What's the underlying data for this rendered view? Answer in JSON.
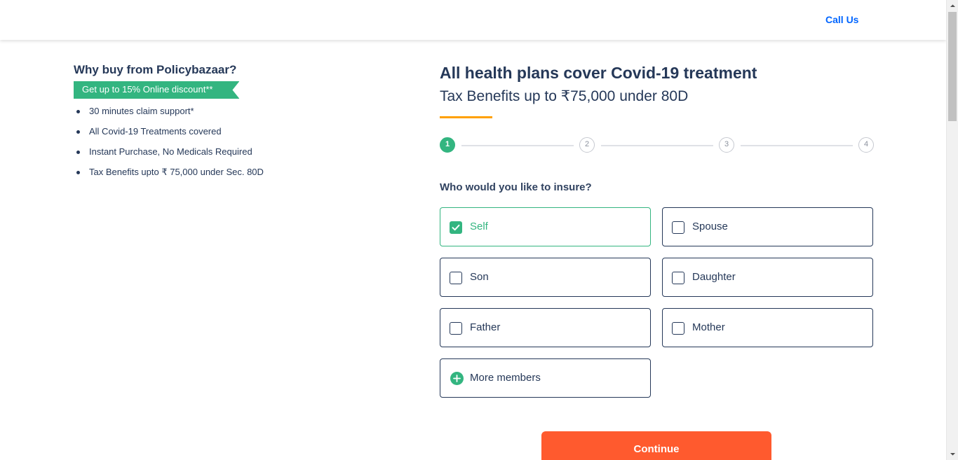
{
  "header": {
    "call_us": "Call Us"
  },
  "why_buy": {
    "title": "Why buy from Policybazaar?",
    "ribbon": "Get up to 15% Online discount**",
    "items": [
      "30 minutes claim support*",
      "All Covid-19 Treatments covered",
      "Instant Purchase, No Medicals Required",
      "Tax Benefits upto ₹ 75,000 under Sec. 80D"
    ]
  },
  "main": {
    "headline": "All health plans cover Covid-19 treatment",
    "subline": "Tax Benefits up to ₹75,000 under 80D",
    "steps": [
      "1",
      "2",
      "3",
      "4"
    ],
    "active_step": 1,
    "question": "Who would you like to insure?",
    "members": [
      {
        "label": "Self",
        "checked": true
      },
      {
        "label": "Spouse",
        "checked": false
      },
      {
        "label": "Son",
        "checked": false
      },
      {
        "label": "Daughter",
        "checked": false
      },
      {
        "label": "Father",
        "checked": false
      },
      {
        "label": "Mother",
        "checked": false
      }
    ],
    "more_members": "More members",
    "continue": "Continue"
  },
  "colors": {
    "accent_green": "#33b580",
    "continue_orange": "#ff5a2e",
    "underline_yellow": "#ffa000",
    "text_navy": "#253858",
    "link_blue": "#0065ff"
  }
}
